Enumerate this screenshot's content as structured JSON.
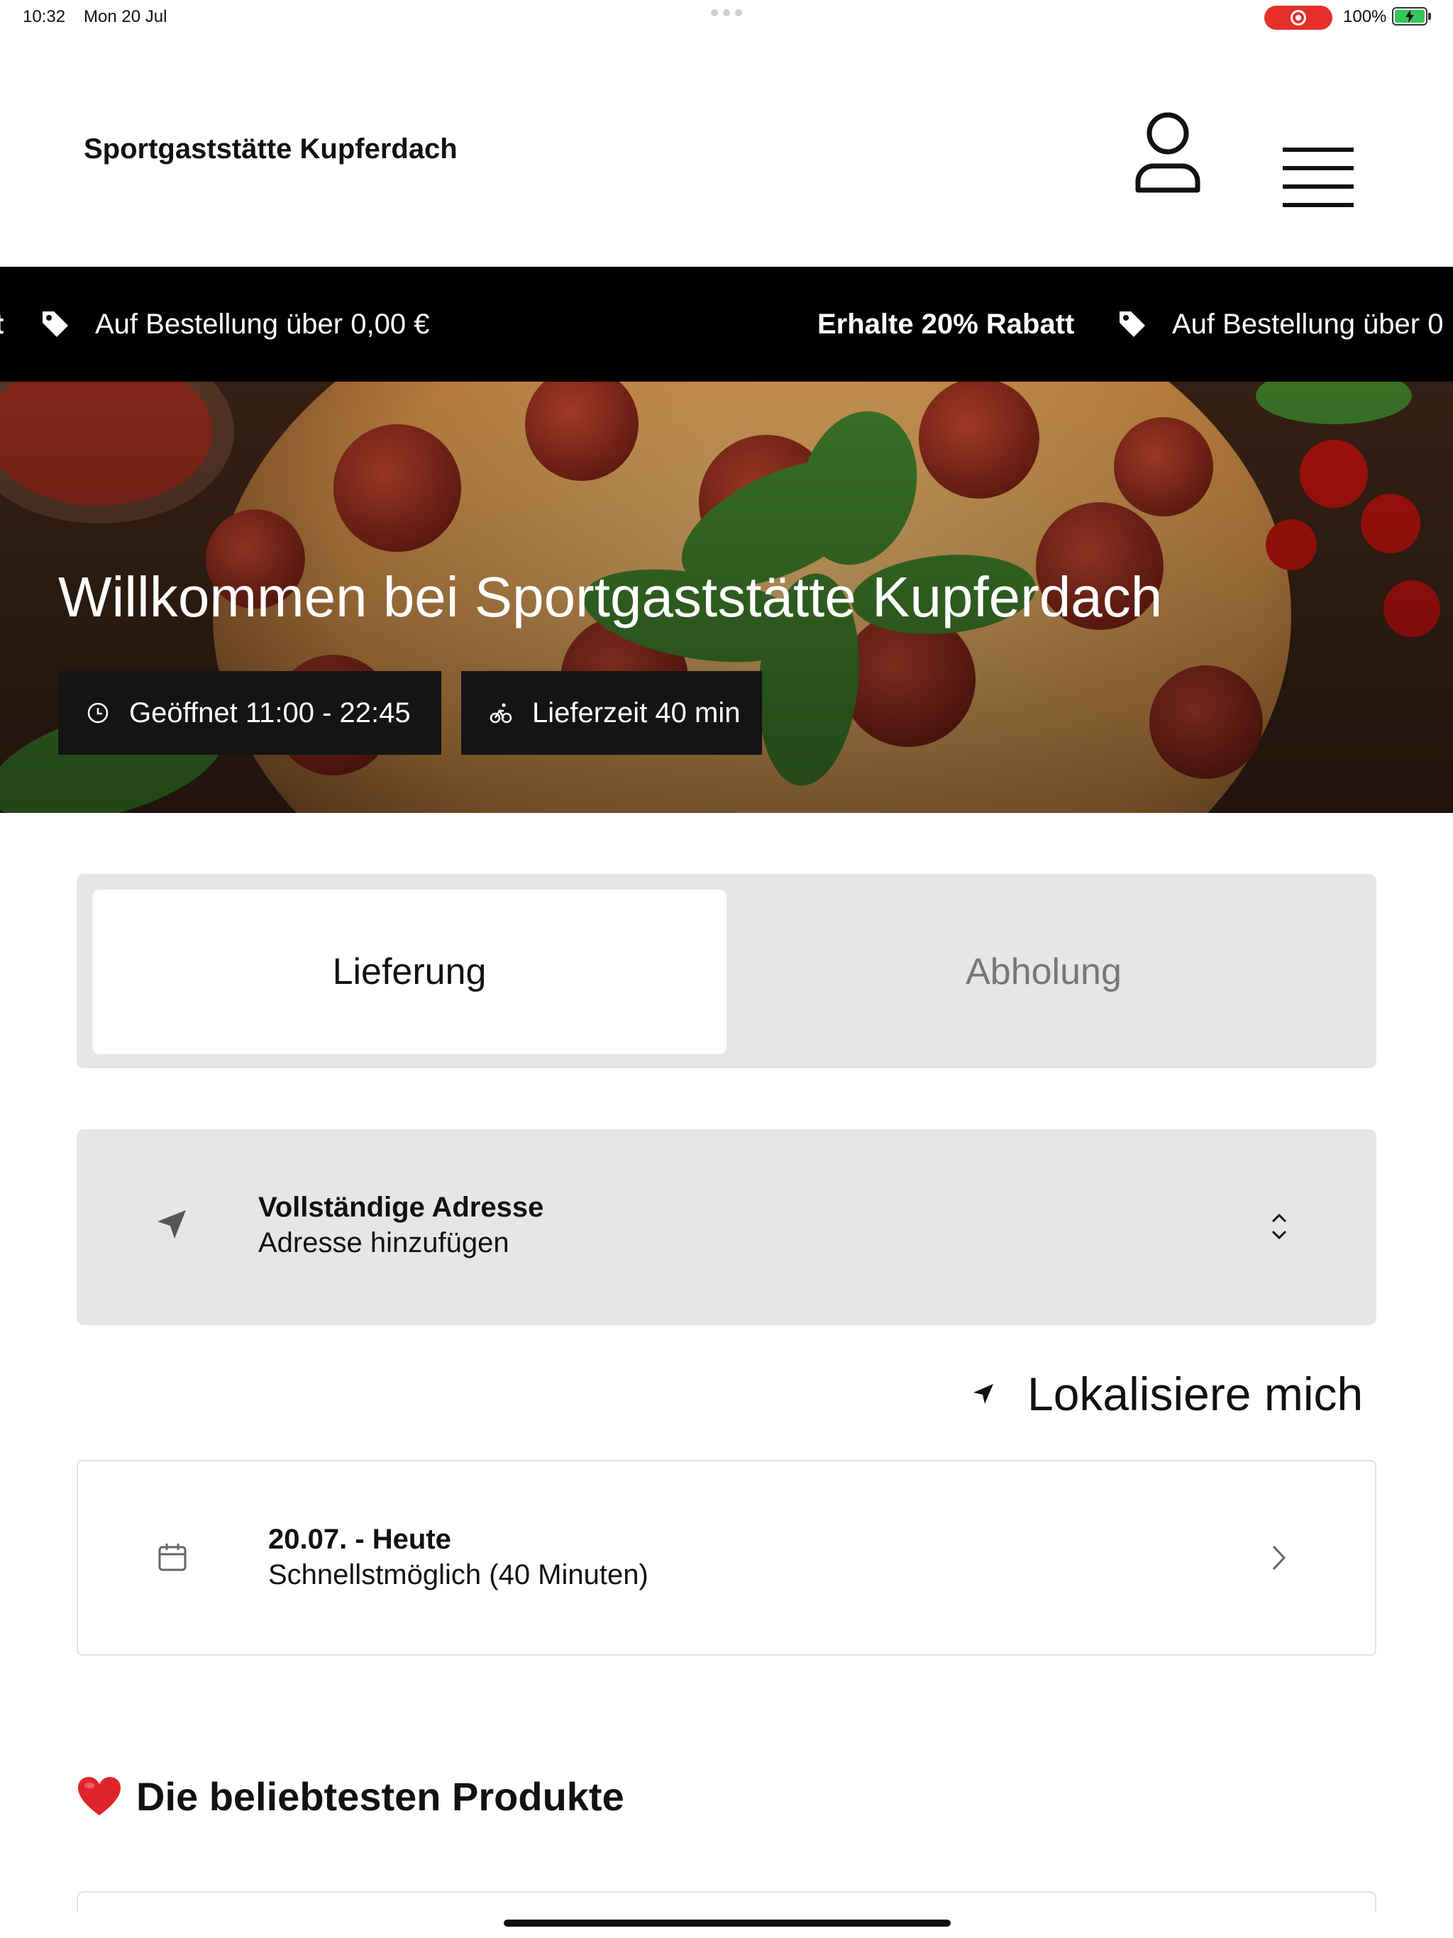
{
  "status_bar": {
    "time": "10:32",
    "date": "Mon 20 Jul",
    "battery": "100%"
  },
  "header": {
    "brand": "Sportgaststätte Kupferdach",
    "icons": [
      "user-icon",
      "hamburger-menu-icon"
    ]
  },
  "ticker": {
    "items": [
      {
        "bold": "t",
        "text": ""
      },
      {
        "bold": "",
        "text": "Auf Bestellung über 0,00 €"
      },
      {
        "bold": "Erhalte 20% Rabatt",
        "text": ""
      },
      {
        "bold": "",
        "text": "Auf Bestellung über 0"
      }
    ]
  },
  "hero": {
    "title": "Willkommen bei Sportgaststätte Kupferdach",
    "open_hours": "Geöffnet 11:00 - 22:45",
    "delivery_time": "Lieferzeit 40 min"
  },
  "order_mode": {
    "options": [
      "Lieferung",
      "Abholung"
    ],
    "selected": "Lieferung"
  },
  "address": {
    "title": "Vollständige Adresse",
    "subtitle": "Adresse hinzufügen"
  },
  "locate_me": "Lokalisiere mich",
  "schedule": {
    "title": "20.07. - Heute",
    "subtitle": "Schnellstmöglich (40 Minuten)"
  },
  "popular": {
    "title": "Die beliebtesten Produkte"
  },
  "colors": {
    "accent_black": "#000000",
    "panel_gray": "#e6e6e6",
    "record_red": "#e5302a",
    "battery_green": "#34c759",
    "heart_red": "#e0242b"
  }
}
